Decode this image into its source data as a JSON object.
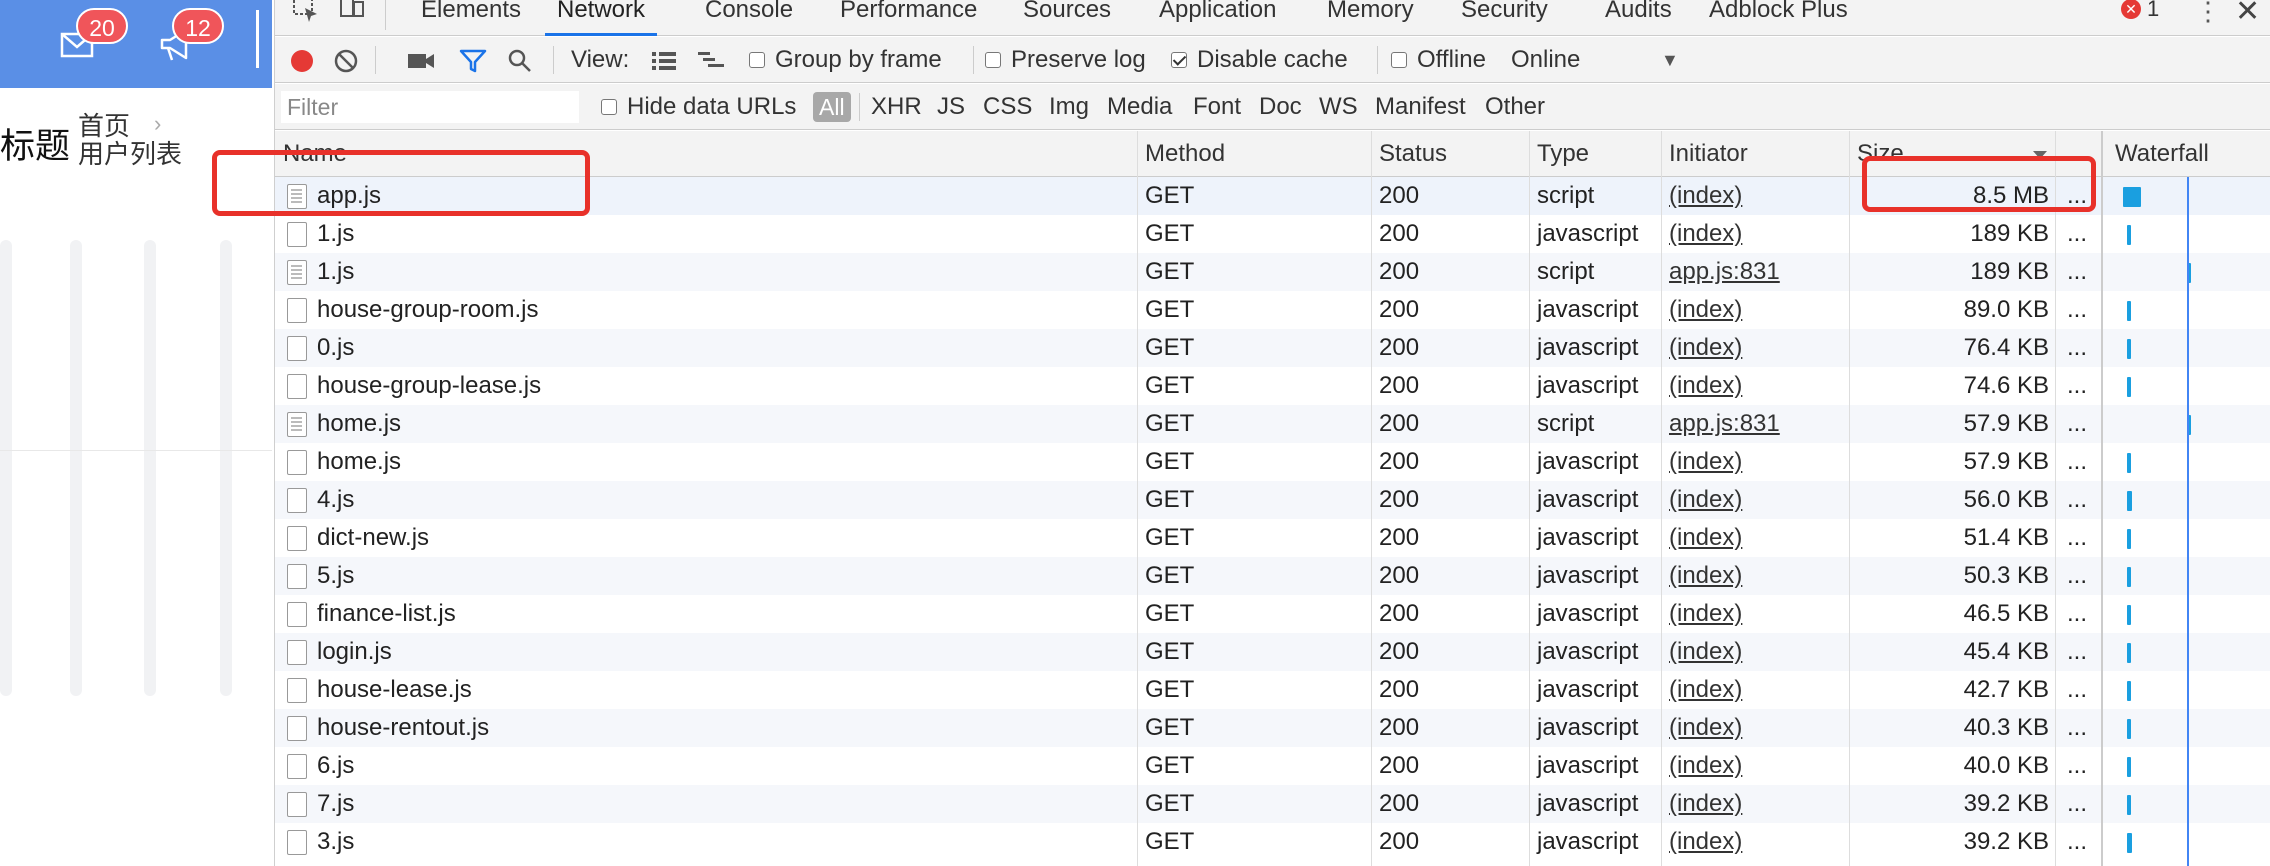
{
  "app": {
    "mail_badge": "20",
    "notice_badge": "12",
    "page_title": "标题",
    "breadcrumb": [
      "首页",
      "用户列表"
    ]
  },
  "devtools": {
    "tabs": [
      "Elements",
      "Network",
      "Console",
      "Performance",
      "Sources",
      "Application",
      "Memory",
      "Security",
      "Audits",
      "Adblock Plus"
    ],
    "active_tab": "Network",
    "error_count": "1",
    "toolbar": {
      "view_label": "View:",
      "group_by_frame": "Group by frame",
      "preserve_log": "Preserve log",
      "disable_cache": "Disable cache",
      "offline": "Offline",
      "throttle": "Online"
    },
    "filter": {
      "placeholder": "Filter",
      "hide_data_urls": "Hide data URLs",
      "types": [
        "All",
        "XHR",
        "JS",
        "CSS",
        "Img",
        "Media",
        "Font",
        "Doc",
        "WS",
        "Manifest",
        "Other"
      ]
    },
    "columns": {
      "name": "Name",
      "method": "Method",
      "status": "Status",
      "type": "Type",
      "initiator": "Initiator",
      "size": "Size",
      "waterfall": "Waterfall"
    },
    "rows": [
      {
        "name": "app.js",
        "method": "GET",
        "status": "200",
        "type": "script",
        "initiator": "(index)",
        "size": "8.5 MB",
        "more": "..."
      },
      {
        "name": "1.js",
        "method": "GET",
        "status": "200",
        "type": "javascript",
        "initiator": "(index)",
        "size": "189 KB",
        "more": "..."
      },
      {
        "name": "1.js",
        "method": "GET",
        "status": "200",
        "type": "script",
        "initiator": "app.js:831",
        "size": "189 KB",
        "more": "..."
      },
      {
        "name": "house-group-room.js",
        "method": "GET",
        "status": "200",
        "type": "javascript",
        "initiator": "(index)",
        "size": "89.0 KB",
        "more": "..."
      },
      {
        "name": "0.js",
        "method": "GET",
        "status": "200",
        "type": "javascript",
        "initiator": "(index)",
        "size": "76.4 KB",
        "more": "..."
      },
      {
        "name": "house-group-lease.js",
        "method": "GET",
        "status": "200",
        "type": "javascript",
        "initiator": "(index)",
        "size": "74.6 KB",
        "more": "..."
      },
      {
        "name": "home.js",
        "method": "GET",
        "status": "200",
        "type": "script",
        "initiator": "app.js:831",
        "size": "57.9 KB",
        "more": "..."
      },
      {
        "name": "home.js",
        "method": "GET",
        "status": "200",
        "type": "javascript",
        "initiator": "(index)",
        "size": "57.9 KB",
        "more": "..."
      },
      {
        "name": "4.js",
        "method": "GET",
        "status": "200",
        "type": "javascript",
        "initiator": "(index)",
        "size": "56.0 KB",
        "more": "..."
      },
      {
        "name": "dict-new.js",
        "method": "GET",
        "status": "200",
        "type": "javascript",
        "initiator": "(index)",
        "size": "51.4 KB",
        "more": "..."
      },
      {
        "name": "5.js",
        "method": "GET",
        "status": "200",
        "type": "javascript",
        "initiator": "(index)",
        "size": "50.3 KB",
        "more": "..."
      },
      {
        "name": "finance-list.js",
        "method": "GET",
        "status": "200",
        "type": "javascript",
        "initiator": "(index)",
        "size": "46.5 KB",
        "more": "..."
      },
      {
        "name": "login.js",
        "method": "GET",
        "status": "200",
        "type": "javascript",
        "initiator": "(index)",
        "size": "45.4 KB",
        "more": "..."
      },
      {
        "name": "house-lease.js",
        "method": "GET",
        "status": "200",
        "type": "javascript",
        "initiator": "(index)",
        "size": "42.7 KB",
        "more": "..."
      },
      {
        "name": "house-rentout.js",
        "method": "GET",
        "status": "200",
        "type": "javascript",
        "initiator": "(index)",
        "size": "40.3 KB",
        "more": "..."
      },
      {
        "name": "6.js",
        "method": "GET",
        "status": "200",
        "type": "javascript",
        "initiator": "(index)",
        "size": "40.0 KB",
        "more": "..."
      },
      {
        "name": "7.js",
        "method": "GET",
        "status": "200",
        "type": "javascript",
        "initiator": "(index)",
        "size": "39.2 KB",
        "more": "..."
      },
      {
        "name": "3.js",
        "method": "GET",
        "status": "200",
        "type": "javascript",
        "initiator": "(index)",
        "size": "39.2 KB",
        "more": "..."
      }
    ]
  },
  "colors": {
    "header_blue": "#5a8fe6",
    "badge_red": "#f0555a",
    "active_tab_blue": "#1a73e8",
    "annotation_red": "#e8312a",
    "record_red": "#e53935",
    "filter_funnel_blue": "#1a73e8"
  }
}
